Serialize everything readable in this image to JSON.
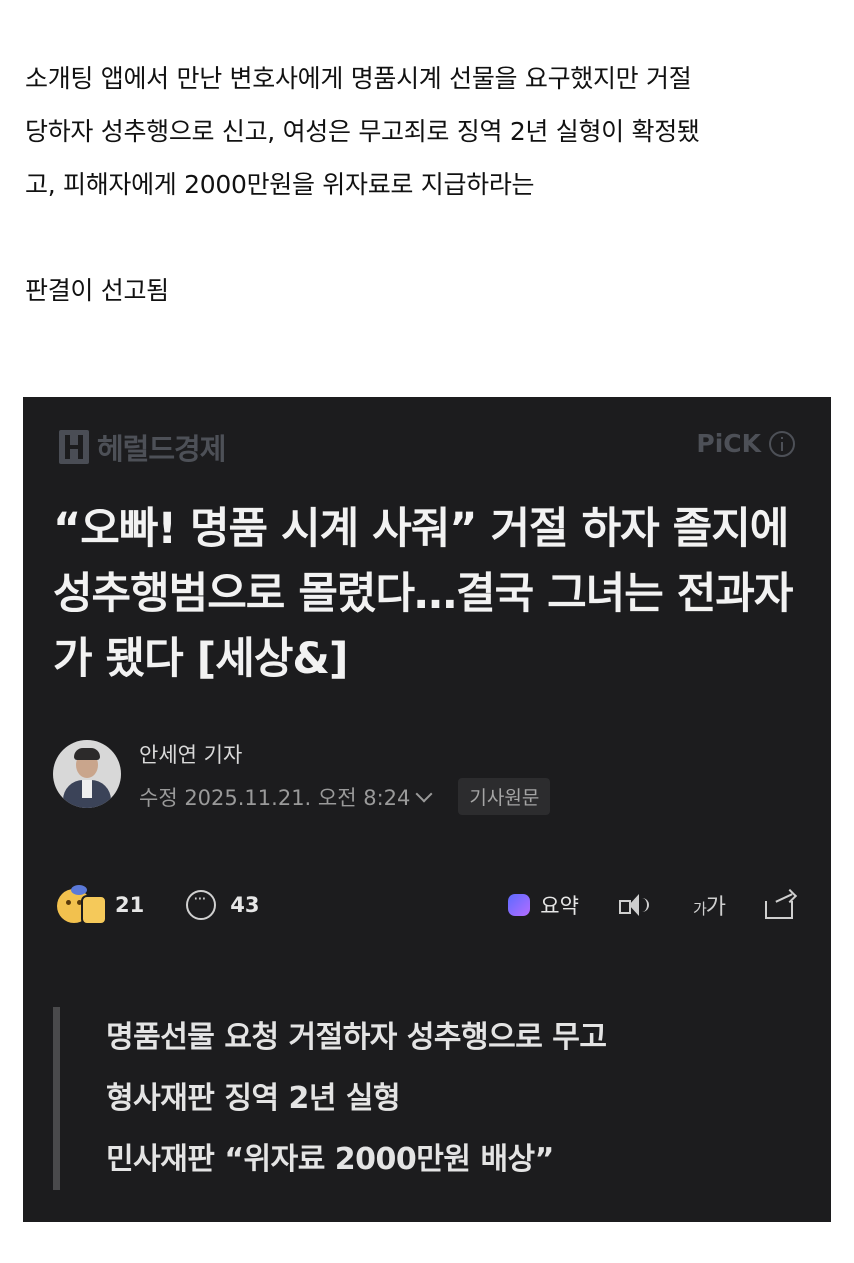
{
  "intro": {
    "line1": "소개팅 앱에서 만난 변호사에게 명품시계 선물을 요구했지만 거절",
    "line2": "당하자 성추행으로 신고, 여성은 무고죄로 징역 2년 실형이 확정됐",
    "line3": "고, 피해자에게 2000만원을 위자료로 지급하라는",
    "line4": "판결이 선고됨"
  },
  "article": {
    "brand": "헤럴드경제",
    "pick_label": "PiCK",
    "headline": "“오빠! 명품 시계 사줘” 거절 하자 졸지에 성추행범으로 몰렸다…결국 그녀는 전과자가 됐다 [세상&]",
    "author": "안세연 기자",
    "modified": "수정 2025.11.21. 오전 8:24",
    "original_button": "기사원문",
    "reactions_count": "21",
    "comments_count": "43",
    "summary_label": "요약",
    "font_size_small": "가",
    "font_size_large": "가",
    "summary": [
      "명품선물 요청 거절하자 성추행으로 무고",
      "형사재판 징역 2년 실형",
      "민사재판 “위자료 2000만원 배상”"
    ],
    "colors": {
      "card_bg": "#1c1c1e",
      "headline": "#f2f2f2",
      "brand": "#4d5057",
      "quote_bar": "#4a4a4c"
    }
  }
}
